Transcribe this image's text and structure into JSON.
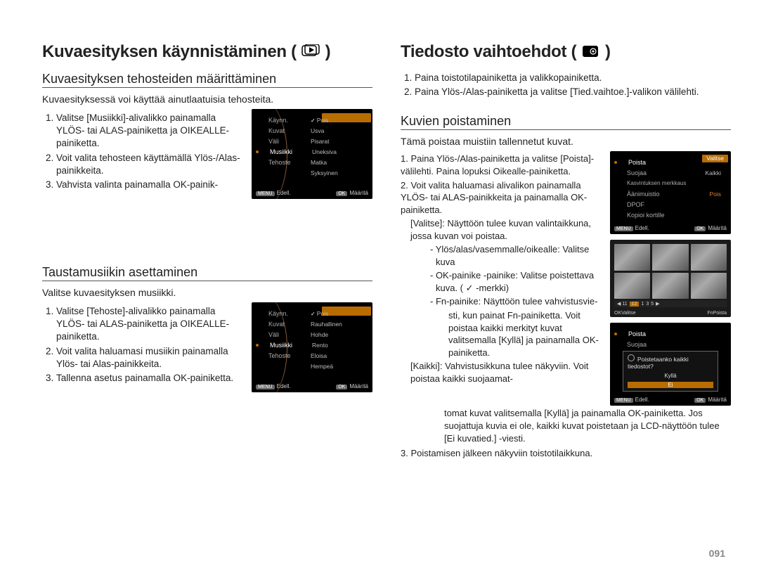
{
  "left": {
    "title": "Kuvaesityksen käynnistäminen (",
    "title_end": ")",
    "sec1": {
      "heading": "Kuvaesityksen tehosteiden määrittäminen",
      "intro": "Kuvaesityksessä voi käyttää ainutlaatuisia tehosteita.",
      "steps": [
        "Valitse [Musiikki]-alivalikko painamalla YLÖS- tai ALAS-painiketta ja OIKEALLE-painiketta.",
        "Voit valita tehosteen käyttämällä Ylös-/Alas-painikkeita.",
        "Vahvista valinta painamalla OK-painik-"
      ],
      "screen": {
        "left_items": [
          "Käynn.",
          "Kuvat",
          "Väli",
          "Musiikki",
          "Tehoste"
        ],
        "right_items": [
          "Pois",
          "Usva",
          "Pisarat",
          "Uneksiva",
          "Matka",
          "Syksyinen"
        ],
        "footer_left": "Edell.",
        "footer_right": "Määritä",
        "footer_left_tag": "MENU",
        "footer_right_tag": "OK"
      }
    },
    "sec2": {
      "heading": "Taustamusiikin asettaminen",
      "intro": "Valitse kuvaesityksen musiikki.",
      "steps": [
        "Valitse [Tehoste]-alivalikko painamalla YLÖS- tai ALAS-painiketta ja OIKEALLE-painiketta.",
        "Voit valita haluamasi musiikin painamalla Ylös- tai Alas-painikkeita.",
        "Tallenna asetus painamalla OK-painiketta."
      ],
      "screen": {
        "left_items": [
          "Käynn.",
          "Kuvat",
          "Väli",
          "Musiikki",
          "Tehoste"
        ],
        "right_items": [
          "Pois",
          "Rauhallinen",
          "Hohde",
          "Rento",
          "Eloisa",
          "Hempeä"
        ],
        "footer_left": "Edell.",
        "footer_right": "Määritä",
        "footer_left_tag": "MENU",
        "footer_right_tag": "OK"
      }
    }
  },
  "right": {
    "title": "Tiedosto vaihtoehdot (",
    "title_end": ")",
    "top_steps": [
      "Paina toistotilapainiketta ja valikkopainiketta.",
      "Paina Ylös-/Alas-painiketta ja valitse [Tied.vaihtoe.]-valikon välilehti."
    ],
    "del": {
      "heading": "Kuvien poistaminen",
      "intro": "Tämä poistaa muistiin tallennetut kuvat.",
      "step1": "Paina Ylös-/Alas-painiketta ja valitse [Poista]-välilehti. Paina lopuksi Oikealle-painiketta.",
      "step2": "Voit valita haluamasi alivalikon painamalla YLÖS- tai ALAS-painikkeita ja painamalla OK-painiketta.",
      "valitse_label": "[Valitse]: Näyttöön tulee kuvan valintaikkuna, jossa kuvan voi poistaa.",
      "bul1": "- Ylös/alas/vasemmalle/oikealle: Valitse kuva",
      "bul2": "- OK-painike -painike: Valitse poistettava kuva. ( ✓ -merkki)",
      "bul3a": "- Fn-painike: Näyttöön tulee vahvistusvie-",
      "bul3b": "sti, kun painat Fn-painiketta. Voit poistaa kaikki merkityt kuvat valitsemalla [Kyllä] ja painamalla OK-painiketta.",
      "kaikki_label": "[Kaikki]: Vahvistusikkuna tulee näkyviin. Voit poistaa kaikki suojaamat-",
      "kaikki_cont": "tomat kuvat valitsemalla [Kyllä] ja painamalla OK-painiketta. Jos suojattuja kuvia ei ole, kaikki kuvat poistetaan ja LCD-näyttöön tulee [Ei kuvatied.] -viesti.",
      "step3": "Poistamisen jälkeen näkyviin toistotilaikkuna.",
      "menu_items": [
        "Poista",
        "Suojaa",
        "Kasvintuksen merkkaus",
        "Äänimuistio",
        "DPOF",
        "Kopioi kortille"
      ],
      "menu_right": [
        "Valitse",
        "Kaikki"
      ],
      "menu_pois": "Pois",
      "dialog_q": "Poistetaanko kaikki tiedostot?",
      "dialog_yes": "Kyllä",
      "dialog_no": "Ei",
      "footer_left": "Edell.",
      "footer_right": "Määritä",
      "thumb_valitse": "Valitse"
    }
  },
  "page_number": "091"
}
